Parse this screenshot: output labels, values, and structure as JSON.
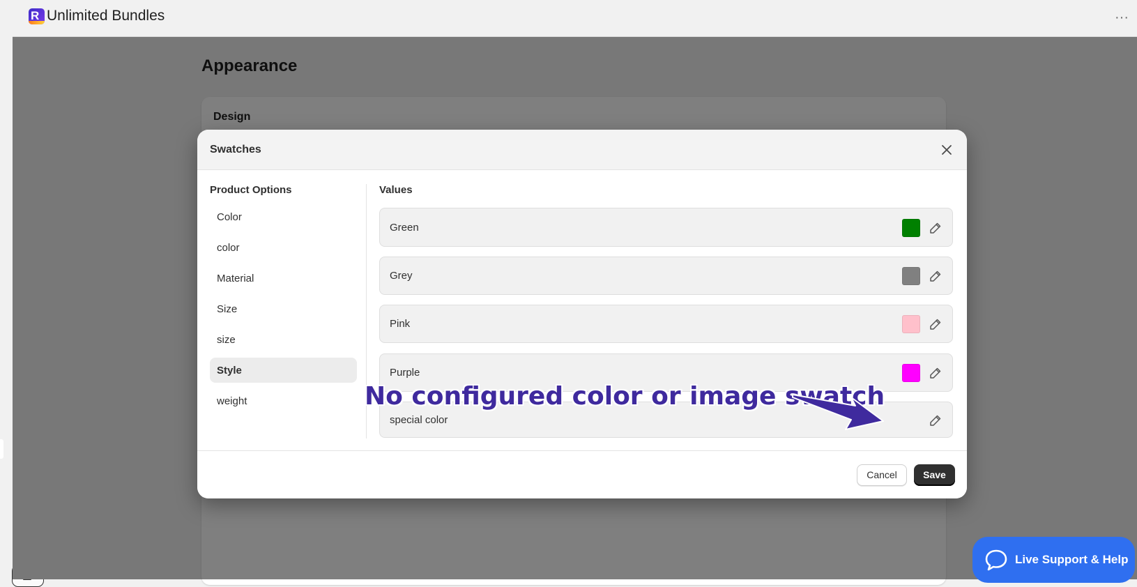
{
  "app": {
    "title": "Unlimited Bundles",
    "logo": "app-logo-icon",
    "more_icon": "more-horizontal-icon",
    "more_glyph": "···"
  },
  "page": {
    "heading": "Appearance",
    "card_title": "Design"
  },
  "modal": {
    "title": "Swatches",
    "close_icon": "close-icon",
    "options_heading": "Product Options",
    "options": [
      {
        "label": "Color",
        "selected": false
      },
      {
        "label": "color",
        "selected": false
      },
      {
        "label": "Material",
        "selected": false
      },
      {
        "label": "Size",
        "selected": false
      },
      {
        "label": "size",
        "selected": false
      },
      {
        "label": "Style",
        "selected": true
      },
      {
        "label": "weight",
        "selected": false
      }
    ],
    "values_heading": "Values",
    "values": [
      {
        "label": "Green",
        "swatch": "#008000"
      },
      {
        "label": "Grey",
        "swatch": "#808080"
      },
      {
        "label": "Pink",
        "swatch": "#ffc0cb"
      },
      {
        "label": "Purple",
        "swatch": "#ff00ff"
      },
      {
        "label": "special color",
        "swatch": null
      }
    ],
    "edit_icon": "pencil-icon",
    "cancel_label": "Cancel",
    "save_label": "Save"
  },
  "annotation": {
    "text": "No configured color or image swatch",
    "color": "#3f2a9e"
  },
  "support": {
    "label": "Live Support & Help",
    "icon": "chat-bubble-icon",
    "color": "#2f6ff0"
  }
}
